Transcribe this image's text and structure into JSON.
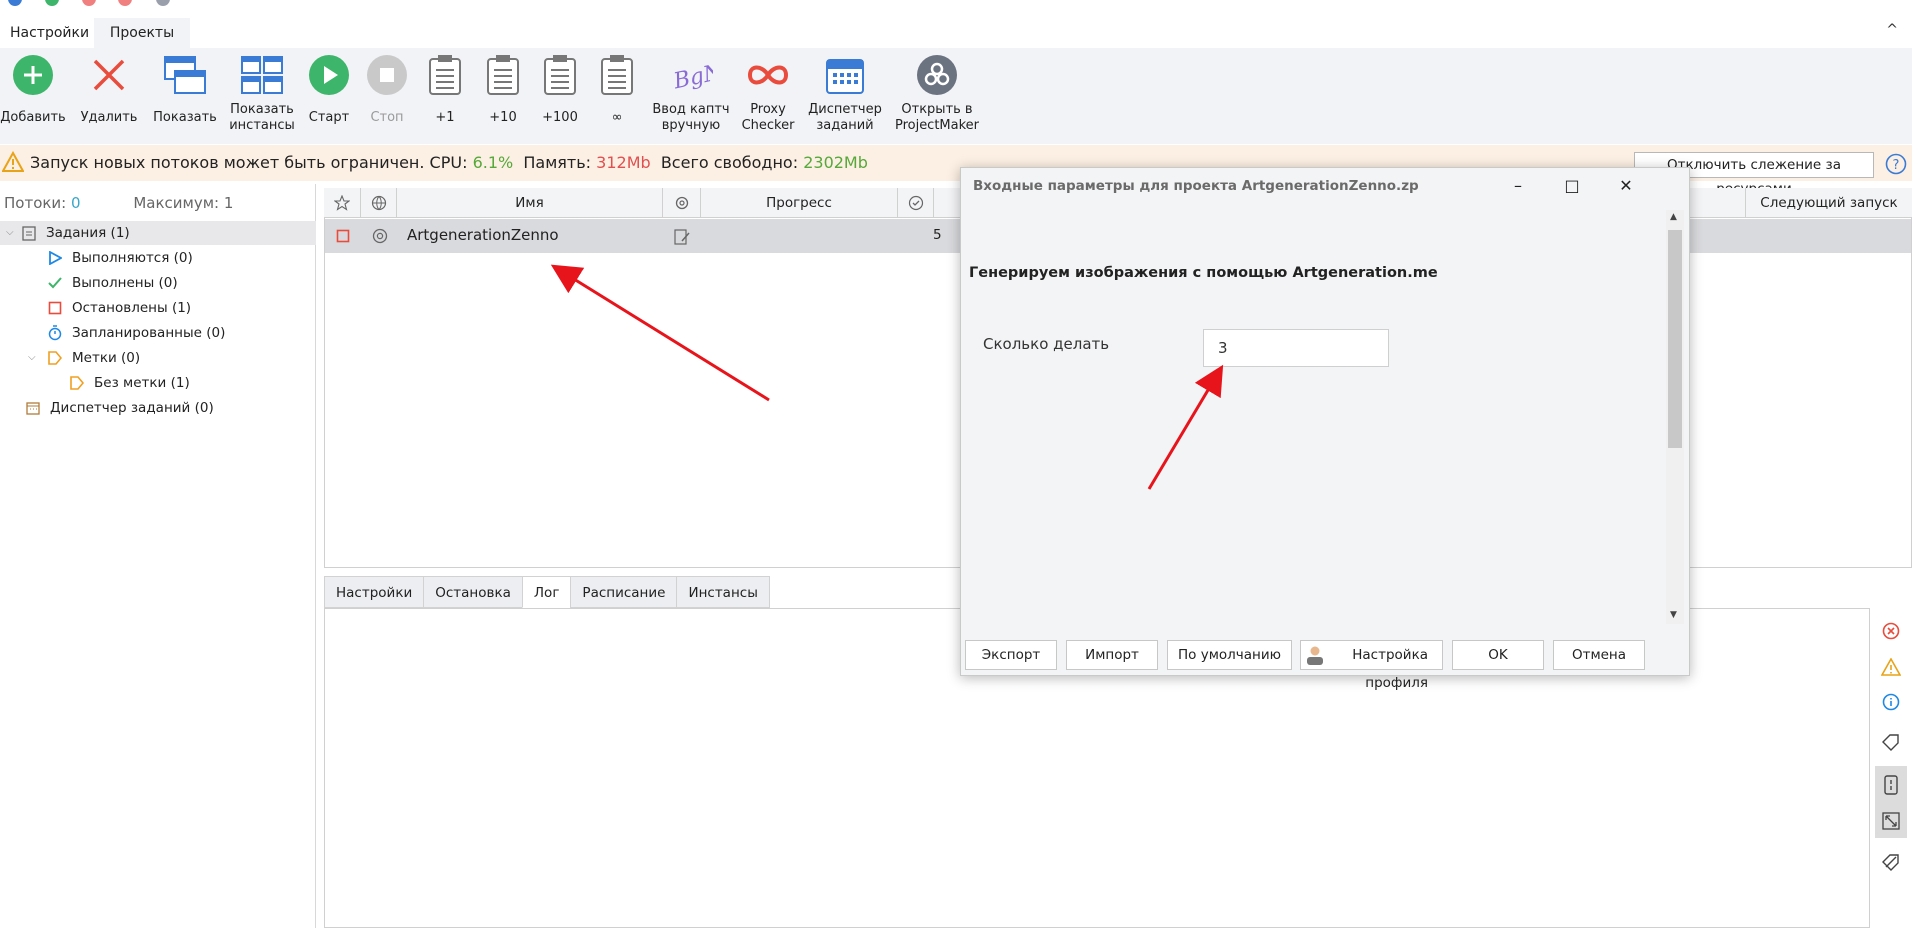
{
  "ribbon": {
    "tabs": [
      "Настройки",
      "Проекты"
    ],
    "collapse": "^"
  },
  "toolbar": {
    "add": "Добавить",
    "delete": "Удалить",
    "show": "Показать",
    "show_instances": "Показать\nинстансы",
    "start": "Старт",
    "stop": "Стоп",
    "plus1": "+1",
    "plus10": "+10",
    "plus100": "+100",
    "infinity": "∞",
    "captcha": "Ввод каптч\nвручную",
    "proxy": "Proxy\nChecker",
    "scheduler": "Диспетчер\nзаданий",
    "projectmaker": "Открыть в\nProjectMaker"
  },
  "warning": {
    "text": "Запуск новых потоков может быть ограничен.",
    "cpu_label": "CPU:",
    "cpu_value": "6.1%",
    "mem_label": "Память:",
    "mem_value": "312Mb",
    "free_label": "Всего свободно:",
    "free_value": "2302Mb",
    "disable_button": "Отключить слежение за ресурсами"
  },
  "left": {
    "threads_label": "Потоки:",
    "threads_value": "0",
    "max_label": "Максимум:",
    "max_value": "1",
    "tree": {
      "tasks": "Задания (1)",
      "running": "Выполняются (0)",
      "done": "Выполнены (0)",
      "stopped": "Остановлены (1)",
      "scheduled": "Запланированные (0)",
      "tags": "Метки (0)",
      "no_tag": "Без метки (1)",
      "dispatcher": "Диспетчер заданий (0)"
    }
  },
  "grid": {
    "col_name": "Имя",
    "col_progress": "Прогресс",
    "col_next": "Следующий запуск",
    "row": {
      "name": "ArtgenerationZenno",
      "count": "5"
    }
  },
  "bottom_tabs": [
    "Настройки",
    "Остановка",
    "Лог",
    "Расписание",
    "Инстансы"
  ],
  "dialog": {
    "title": "Входные параметры для проекта ArtgenerationZenno.zp",
    "minimize": "–",
    "maximize": "□",
    "close": "✕",
    "heading": "Генерируем изображения с помощью Artgeneration.me",
    "field_label": "Сколько делать",
    "field_value": "3",
    "buttons": {
      "export": "Экспорт",
      "import": "Импорт",
      "default": "По умолчанию",
      "profile": "Настройка профиля",
      "ok": "OK",
      "cancel": "Отмена"
    }
  },
  "colors": {
    "accent_green": "#3db56a",
    "warning_bg": "#fcefe3",
    "arrow_red": "#e8141b",
    "toolbar_bg": "#f1f3f6"
  }
}
